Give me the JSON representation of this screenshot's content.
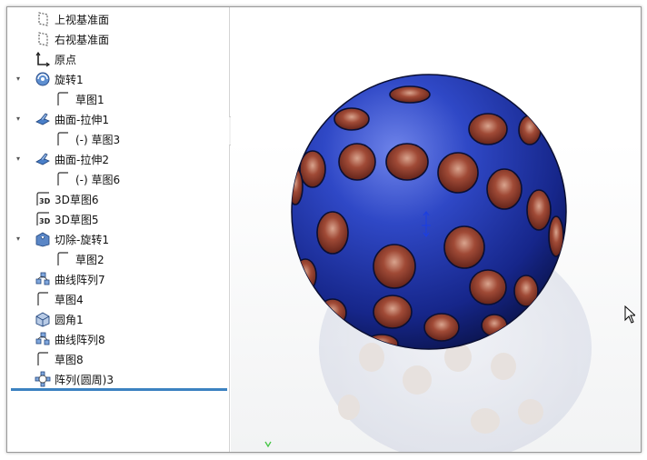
{
  "feature_tree": {
    "items": [
      {
        "label": "上视基准面",
        "icon": "plane-icon",
        "expander": ""
      },
      {
        "label": "右视基准面",
        "icon": "plane-icon",
        "expander": ""
      },
      {
        "label": "原点",
        "icon": "origin-icon",
        "expander": ""
      },
      {
        "label": "旋转1",
        "icon": "revolve-icon",
        "expander": "▾"
      },
      {
        "label": "草图1",
        "icon": "sketch-icon",
        "expander": ""
      },
      {
        "label": "曲面-拉伸1",
        "icon": "surface-extrude-icon",
        "expander": "▾"
      },
      {
        "label": "(-) 草图3",
        "icon": "sketch-icon",
        "expander": ""
      },
      {
        "label": "曲面-拉伸2",
        "icon": "surface-extrude-icon",
        "expander": "▾"
      },
      {
        "label": "(-) 草图6",
        "icon": "sketch-icon",
        "expander": ""
      },
      {
        "label": "3D草图6",
        "icon": "3d-sketch-icon",
        "expander": ""
      },
      {
        "label": "3D草图5",
        "icon": "3d-sketch-icon",
        "expander": ""
      },
      {
        "label": "切除-旋转1",
        "icon": "cut-revolve-icon",
        "expander": "▾"
      },
      {
        "label": "草图2",
        "icon": "sketch-icon",
        "expander": ""
      },
      {
        "label": "曲线阵列7",
        "icon": "curve-pattern-icon",
        "expander": ""
      },
      {
        "label": "草图4",
        "icon": "sketch-icon",
        "expander": ""
      },
      {
        "label": "圆角1",
        "icon": "fillet-icon",
        "expander": ""
      },
      {
        "label": "曲线阵列8",
        "icon": "curve-pattern-icon",
        "expander": ""
      },
      {
        "label": "草图8",
        "icon": "sketch-icon",
        "expander": ""
      },
      {
        "label": "阵列(圆周)3",
        "icon": "circular-pattern-icon",
        "expander": ""
      }
    ]
  },
  "viewport": {
    "model": "dimpled-sphere",
    "colors": {
      "sphere": "#2a3fb5",
      "dimple": "#8a3a2c",
      "background": "#ffffff"
    }
  }
}
